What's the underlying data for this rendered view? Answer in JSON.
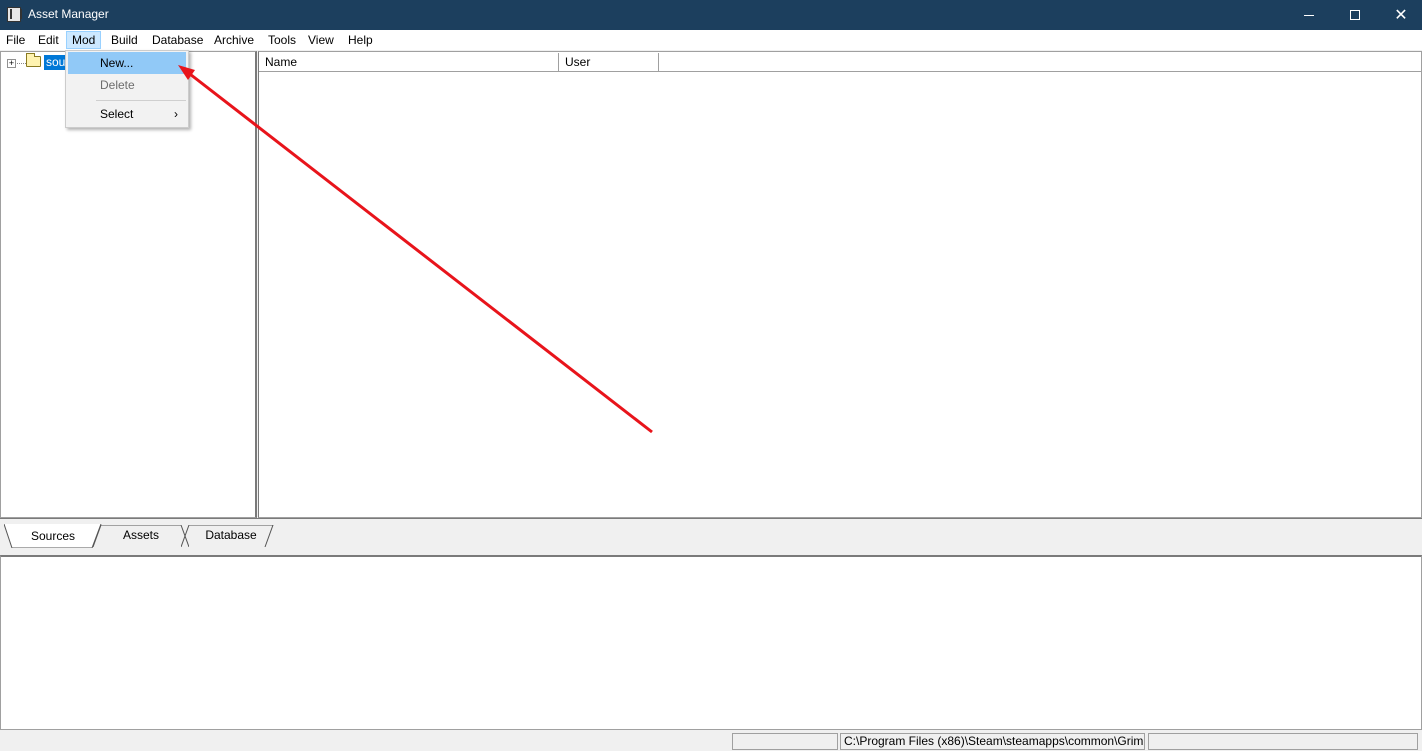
{
  "window": {
    "title": "Asset Manager",
    "controls": {
      "minimize": "minimize",
      "maximize": "maximize",
      "close": "✕"
    }
  },
  "menubar": {
    "items": [
      "File",
      "Edit",
      "Mod",
      "Build",
      "Database",
      "Archive",
      "Tools",
      "View",
      "Help"
    ],
    "active": "Mod"
  },
  "mod_menu": {
    "items": [
      {
        "label": "New...",
        "state": "highlighted"
      },
      {
        "label": "Delete",
        "state": "disabled"
      },
      {
        "label": "Select",
        "state": "normal",
        "submenu_arrow": "›"
      }
    ]
  },
  "tree": {
    "expander": "+",
    "root_label": "sou"
  },
  "list": {
    "columns": [
      "Name",
      "User",
      ""
    ]
  },
  "tabs": {
    "items": [
      "Sources",
      "Assets",
      "Database"
    ],
    "selected": "Sources"
  },
  "statusbar": {
    "panels": [
      "",
      "C:\\Program Files (x86)\\Steam\\steamapps\\common\\Grim",
      ""
    ]
  },
  "annotation": {
    "type": "arrow",
    "color": "#e8141b",
    "points_to": "New..."
  }
}
